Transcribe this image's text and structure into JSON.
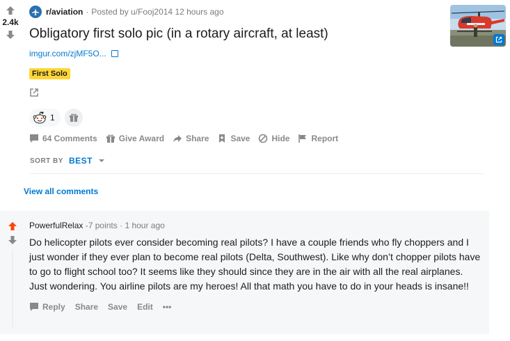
{
  "post": {
    "score": "2.4k",
    "subreddit": "r/aviation",
    "separator": "·",
    "posted_by": "Posted by u/Fooj2014 12 hours ago",
    "title": "Obligatory first solo pic (in a rotary aircraft, at least)",
    "domain": "imgur.com/zjMF5O...",
    "flair": "First Solo",
    "award_count": "1",
    "actions": {
      "comments": "64 Comments",
      "give_award": "Give Award",
      "share": "Share",
      "save": "Save",
      "hide": "Hide",
      "report": "Report"
    },
    "thumbnail_icon": "external-link-icon"
  },
  "sort": {
    "label": "SORT BY",
    "value": "BEST"
  },
  "view_all": "View all comments",
  "comment": {
    "author": "PowerfulRelax",
    "points": "-7 points",
    "separator": "·",
    "time": "1 hour ago",
    "text": "Do helicopter pilots ever consider becoming real pilots? I have a couple friends who fly choppers and I just wonder if they ever plan to become real pilots (Delta, Southwest). Like why don’t chopper pilots have to go to flight school too? It seems like they should since they are in the air with all the real airplanes. Just wondering. You airline pilots are my heroes! All that math you have to do in your heads is insane!!",
    "actions": {
      "reply": "Reply",
      "share": "Share",
      "save": "Save",
      "edit": "Edit",
      "more": "•••"
    }
  },
  "colors": {
    "accent": "#0079d3",
    "upvote_active": "#ff4500",
    "flair_bg": "#ffd635",
    "muted": "#878a8c"
  }
}
